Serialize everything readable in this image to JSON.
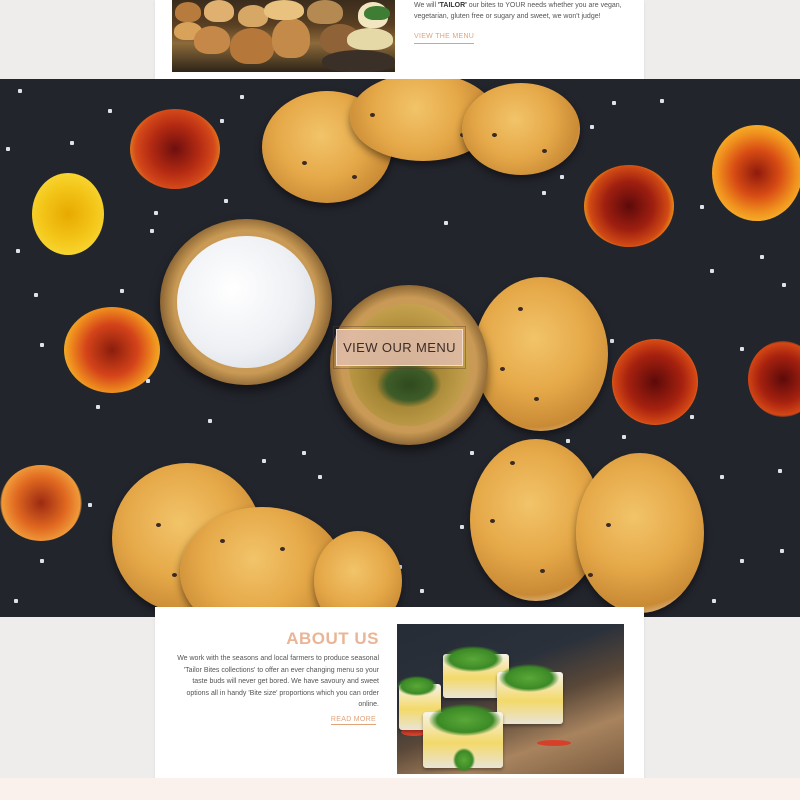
{
  "tailor_section": {
    "text_before": "We will ",
    "text_highlight": "'TAILOR'",
    "text_after": " our bites to YOUR needs whether you are vegan, vegetarian, gluten free or sugary and sweet, we won't judge!",
    "link_label": "VIEW THE MENU"
  },
  "hero": {
    "button_label": "VIEW OUR MENU"
  },
  "about": {
    "title": "ABOUT US",
    "body": "We work with the seasons and local farmers to produce seasonal 'Tailor Bites collections' to offer an ever changing menu so your taste buds will never get bored. We have savoury and sweet options all in handy 'Bite size' proportions which you can order online.",
    "link_label": "READ MORE"
  },
  "colors": {
    "page_background": "#eeedeb",
    "card_background": "#ffffff",
    "accent": "#e9b596",
    "link": "#e0a27a",
    "hero_background": "#23252d",
    "button_fill": "#e0bdaa"
  }
}
